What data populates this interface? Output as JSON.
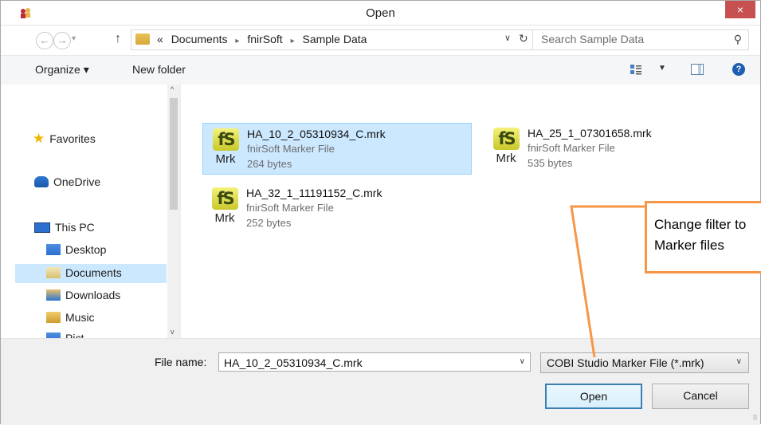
{
  "window": {
    "title": "Open",
    "close_glyph": "×"
  },
  "nav": {
    "back_glyph": "←",
    "forward_glyph": "→",
    "recent_glyph": "▾",
    "up_glyph": "↑",
    "breadcrumb": {
      "overflow": "«",
      "items": [
        "Documents",
        "fnirSoft",
        "Sample Data"
      ],
      "separator": "▸"
    },
    "address_dropdown_glyph": "∨",
    "refresh_glyph": "↻",
    "search_placeholder": "Search Sample Data",
    "search_glyph": "⚲"
  },
  "commandbar": {
    "organize_label": "Organize ▾",
    "new_folder_label": "New folder",
    "view_dropdown_glyph": "▼",
    "help_glyph": "?"
  },
  "sidebar": {
    "items": [
      {
        "label": "Favorites",
        "icon": "star-icon"
      },
      {
        "label": "OneDrive",
        "icon": "cloud-icon"
      },
      {
        "label": "This PC",
        "icon": "computer-icon"
      },
      {
        "label": "Desktop",
        "icon": "desktop-folder-icon"
      },
      {
        "label": "Documents",
        "icon": "documents-folder-icon",
        "selected": true
      },
      {
        "label": "Downloads",
        "icon": "downloads-folder-icon"
      },
      {
        "label": "Music",
        "icon": "music-folder-icon"
      },
      {
        "label": "Pict",
        "icon": "pictures-folder-icon"
      }
    ],
    "scroll_up_glyph": "^",
    "scroll_down_glyph": "v"
  },
  "files": [
    {
      "name": "HA_10_2_05310934_C.mrk",
      "type": "fnirSoft Marker File",
      "size": "264 bytes",
      "selected": true
    },
    {
      "name": "HA_25_1_07301658.mrk",
      "type": "fnirSoft Marker File",
      "size": "535 bytes",
      "selected": false
    },
    {
      "name": "HA_32_1_11191152_C.mrk",
      "type": "fnirSoft Marker File",
      "size": "252 bytes",
      "selected": false
    }
  ],
  "file_icon": {
    "badge": "fS",
    "label": "Mrk"
  },
  "callout": {
    "line1": "Change filter to",
    "line2": "Marker files",
    "color": "#f79646"
  },
  "bottom": {
    "file_name_label": "File name:",
    "file_name_value": "HA_10_2_05310934_C.mrk",
    "file_name_dropdown_glyph": "∨",
    "filter_value": "COBI Studio Marker File (*.mrk)",
    "filter_dropdown_glyph": "∨",
    "open_label": "Open",
    "cancel_label": "Cancel",
    "grip_glyph": "⠿"
  },
  "colors": {
    "close_button": "#c75050",
    "selection": "#cce8ff",
    "accent": "#3c7fb1"
  }
}
